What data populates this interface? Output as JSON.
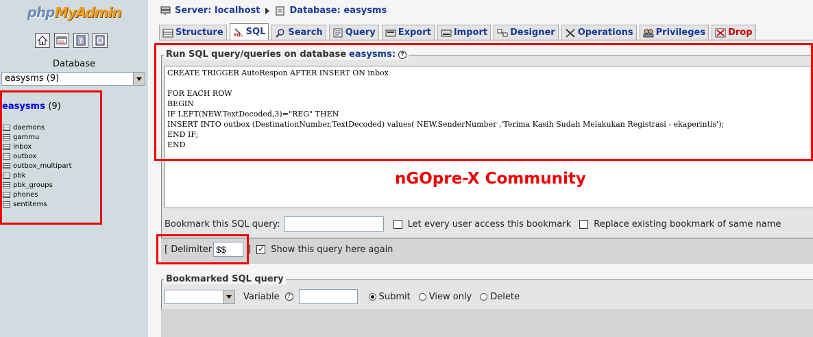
{
  "left": {
    "logo_php": "php",
    "logo_myadmin": "MyAdmin",
    "icons": [
      "home-icon",
      "sql-query-icon",
      "docs-icon",
      "sql-docs-icon"
    ],
    "database_label": "Database",
    "database_select": "easysms (9)",
    "db_heading_name": "easysms",
    "db_heading_count": "(9)",
    "tables": [
      "daemons",
      "gammu",
      "inbox",
      "outbox",
      "outbox_multipart",
      "pbk",
      "pbk_groups",
      "phones",
      "sentitems"
    ]
  },
  "breadcrumb": {
    "server": "Server: localhost",
    "database": "Database: easysms"
  },
  "tabs": [
    {
      "label": "Structure"
    },
    {
      "label": "SQL"
    },
    {
      "label": "Search"
    },
    {
      "label": "Query"
    },
    {
      "label": "Export"
    },
    {
      "label": "Import"
    },
    {
      "label": "Designer"
    },
    {
      "label": "Operations"
    },
    {
      "label": "Privileges"
    },
    {
      "label": "Drop"
    }
  ],
  "sql_panel": {
    "legend_prefix": "Run SQL query/queries on database",
    "legend_db": "easysms:",
    "query_text": "CREATE TRIGGER AutoRespon AFTER INSERT ON inbox\n\nFOR EACH ROW\nBEGIN\nIF LEFT(NEW.TextDecoded,3)=\"REG\" THEN\nINSERT INTO outbox (DestinationNumber,TextDecoded) values( NEW.SenderNumber ,'Terima Kasih Sudah Melakukan Registrasi - ekaperintis');\nEND IF;\nEND",
    "watermark": "nGOpre-X Community",
    "bookmark_label": "Bookmark this SQL query:",
    "bookmark_value": "",
    "let_every_user": "Let every user access this bookmark",
    "replace_existing": "Replace existing bookmark of same name",
    "delimiter_open": "[ Delimiter",
    "delimiter_value": "$$",
    "delimiter_close": "]",
    "show_again": "Show this query here again"
  },
  "bookmarked": {
    "legend": "Bookmarked SQL query",
    "select_value": "",
    "variable_label": "Variable",
    "variable_value": "",
    "radio_submit": "Submit",
    "radio_view": "View only",
    "radio_delete": "Delete"
  },
  "colors": {
    "highlight_red": "#e00000",
    "link_blue": "#1a3a9a",
    "sidebar_bg": "#d0dce0"
  }
}
